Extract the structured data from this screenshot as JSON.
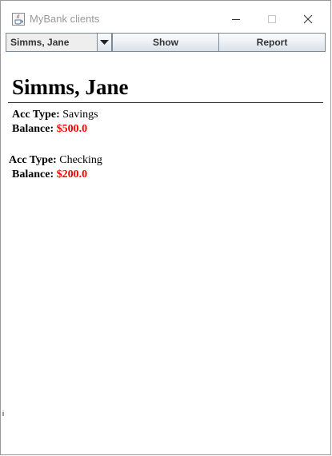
{
  "window": {
    "title": "MyBank clients",
    "app_icon": "java-cup-icon",
    "controls": [
      "minimize-icon",
      "maximize-icon",
      "close-icon"
    ]
  },
  "toolbar": {
    "client_select": {
      "selected": "Simms, Jane"
    },
    "show_label": "Show",
    "report_label": "Report"
  },
  "client": {
    "name": "Simms, Jane",
    "accounts": [
      {
        "type_label": "Acc Type:",
        "type": "Savings",
        "balance_label": "Balance:",
        "balance": "$500.0"
      },
      {
        "type_label": "Acc Type:",
        "type": "Checking",
        "balance_label": "Balance:",
        "balance": "$200.0"
      }
    ]
  },
  "stray_mark": "i",
  "colors": {
    "balance": "#ff0000",
    "title_text": "#999999",
    "button_border": "#7a8a99"
  }
}
